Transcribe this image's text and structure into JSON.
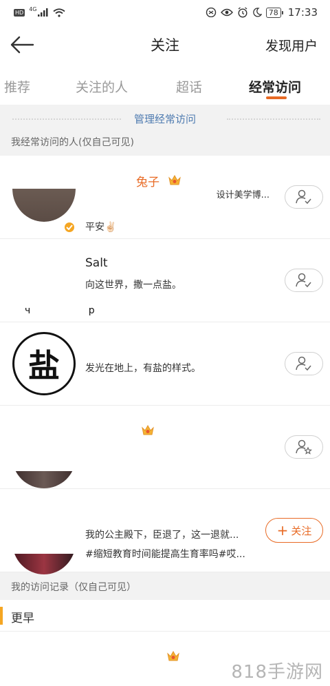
{
  "status_bar": {
    "left_badge": "HD",
    "network": "4G",
    "battery": "78",
    "time": "17:33"
  },
  "nav": {
    "title": "关注",
    "right_action": "发现用户"
  },
  "tabs": [
    {
      "label": "推荐"
    },
    {
      "label": "关注的人"
    },
    {
      "label": "超话"
    },
    {
      "label": "经常访问",
      "active": true
    }
  ],
  "manage_link": "管理经常访问",
  "frequent_section_label": "我经常访问的人(仅自己可见)",
  "users": [
    {
      "name": "兔子",
      "subtitle": "设计美学博...",
      "desc": "平安✌🏻",
      "badge": "crown",
      "verified": true,
      "follow_state": "following"
    },
    {
      "name": "Salt",
      "desc": "向这世界，撒一点盐。",
      "follow_state": "following",
      "avatar_marks": "ч р"
    },
    {
      "desc": "发光在地上，有盐的样式。",
      "avatar_char": "盐",
      "follow_state": "following"
    },
    {
      "badge": "crown",
      "follow_state": "special"
    },
    {
      "desc": "我的公主殿下，臣退了，这一退就...",
      "desc2": "#缩短教育时间能提高生育率吗#哎...",
      "follow_label": "关注",
      "follow_state": "not_following"
    }
  ],
  "history_label": "我的访问记录（仅自己可见）",
  "history_group": "更早",
  "watermark": "818手游网",
  "colors": {
    "accent": "#e86a24",
    "link": "#4e7bb0",
    "badge": "#f5a623"
  }
}
